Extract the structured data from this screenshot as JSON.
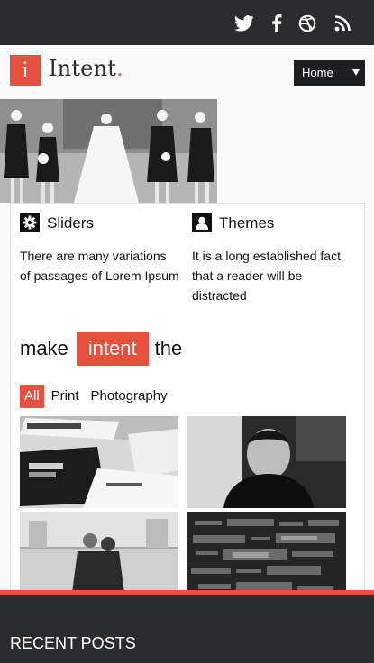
{
  "social": {
    "icons": [
      "twitter-icon",
      "facebook-icon",
      "dribbble-icon",
      "rss-icon"
    ]
  },
  "header": {
    "logo_letter": "i",
    "logo_text": "Intent",
    "logo_dot": ".",
    "nav_selected": "Home"
  },
  "features": [
    {
      "icon": "gear-icon",
      "title": "Sliders",
      "text": "There are many variations of passages of Lorem Ipsum"
    },
    {
      "icon": "user-icon",
      "title": "Themes",
      "text": "It is a long established fact that a reader will be distracted"
    }
  ],
  "tagline": {
    "before": "make",
    "highlight": "intent",
    "after": "the"
  },
  "filters": [
    "All",
    "Print",
    "Photography"
  ],
  "portfolio": {
    "active_filter": "All",
    "thumbnails": [
      "business-cards-photo",
      "portrait-photo",
      "couple-photo",
      "word-cloud-photo"
    ]
  },
  "footer": {
    "title": "RECENT POSTS"
  },
  "colors": {
    "accent": "#e8503e",
    "dark": "#2b2c2e"
  }
}
